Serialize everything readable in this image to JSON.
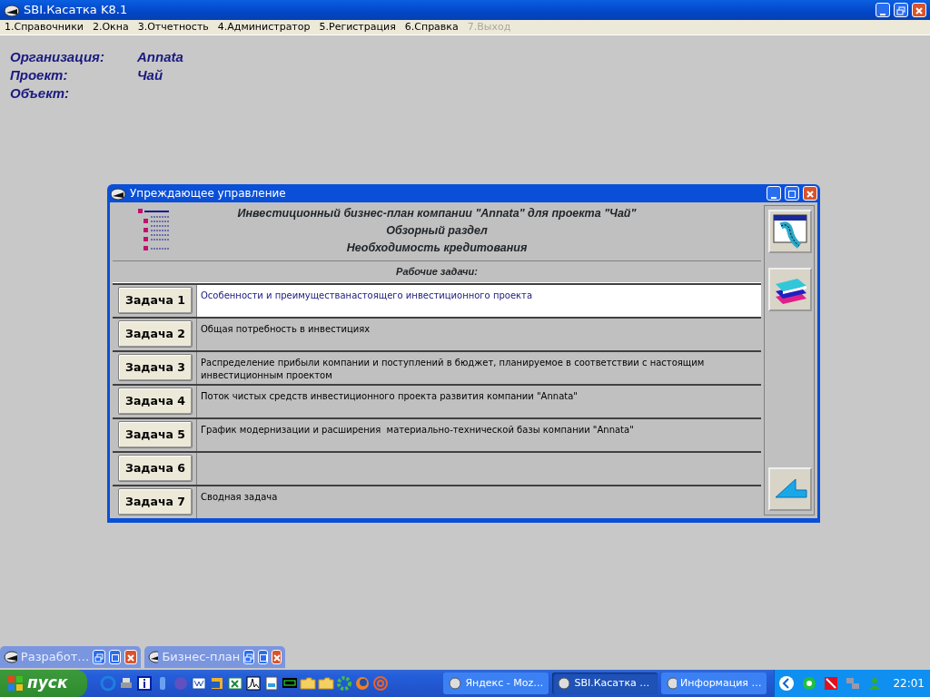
{
  "window": {
    "title": "SBI.Касатка K8.1"
  },
  "menu": [
    {
      "label": "1.Справочники",
      "disabled": false
    },
    {
      "label": "2.Окна",
      "disabled": false
    },
    {
      "label": "3.Отчетность",
      "disabled": false
    },
    {
      "label": "4.Администратор",
      "disabled": false
    },
    {
      "label": "5.Регистрация",
      "disabled": false
    },
    {
      "label": "6.Справка",
      "disabled": false
    },
    {
      "label": "7.Выход",
      "disabled": true
    }
  ],
  "info": [
    {
      "label": "Организация:",
      "value": "Annata"
    },
    {
      "label": "Проект:",
      "value": "Чай"
    },
    {
      "label": "Объект:"
    }
  ],
  "dialog": {
    "title": "Упреждающее управление",
    "heading": [
      "Инвестиционный бизнес-план компании \"Annata\" для проекта \"Чай\"",
      "Обзорный раздел",
      "Необходимость кредитования"
    ],
    "tasks_label": "Рабочие задачи:",
    "tasks": [
      {
        "button": "Задача 1",
        "description": "Особенности и преимуществанастоящего инвестиционного проекта",
        "selected": true
      },
      {
        "button": "Задача 2",
        "description": "Общая потребность в инвестициях",
        "selected": false
      },
      {
        "button": "Задача 3",
        "description": "Распределение прибыли компании и поступлений в бюджет, планируемое в соответствии с настоящим инвестиционным проектом",
        "selected": false
      },
      {
        "button": "Задача 4",
        "description": "Поток чистых средств инвестиционного проекта развития компании \"Annata\"",
        "selected": false
      },
      {
        "button": "Задача 5",
        "description": "График модернизации и расширения  материально-технической базы компании \"Annata\"",
        "selected": false
      },
      {
        "button": "Задача 6",
        "selected": false
      },
      {
        "button": "Задача 7",
        "description": "Сводная задача",
        "selected": false
      }
    ]
  },
  "minimized_windows": [
    {
      "title": "Разработ…"
    },
    {
      "title": "Бизнес-план"
    }
  ],
  "taskbar": {
    "start": "пуск",
    "tasks": [
      {
        "label": "Яндекс - Moz…",
        "selected": false
      },
      {
        "label": "SBI.Касатка …",
        "selected": true
      },
      {
        "label": "Информация …",
        "selected": false
      }
    ],
    "clock": "22:01"
  }
}
